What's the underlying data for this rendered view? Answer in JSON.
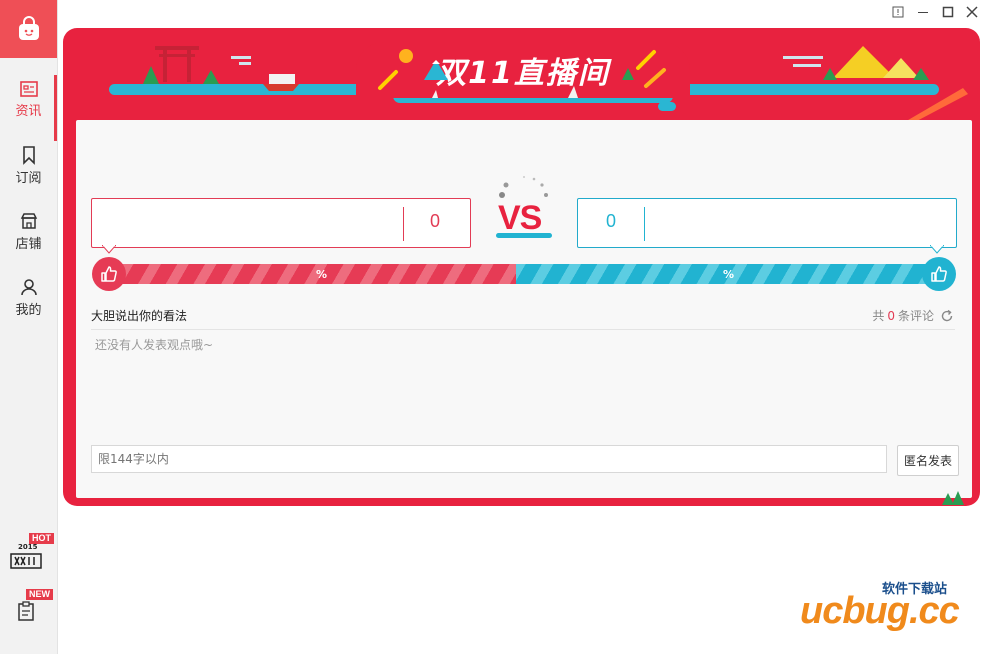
{
  "sidebar": {
    "items": [
      {
        "label": "资讯",
        "icon": "news-icon",
        "active": true
      },
      {
        "label": "订阅",
        "icon": "bookmark-icon",
        "active": false
      },
      {
        "label": "店铺",
        "icon": "shop-icon",
        "active": false
      },
      {
        "label": "我的",
        "icon": "user-icon",
        "active": false
      }
    ],
    "promo": [
      {
        "badge": "HOT",
        "icon": "double11-2015-icon",
        "logo_text": "2015"
      },
      {
        "badge": "NEW",
        "icon": "clipboard-icon"
      }
    ]
  },
  "window": {
    "controls": [
      "warning-icon",
      "minimize-icon",
      "maximize-icon",
      "close-icon"
    ]
  },
  "banner": {
    "title": "双11直播间"
  },
  "versus": {
    "label": "VS",
    "left": {
      "count": "0",
      "percent_label": "%"
    },
    "right": {
      "count": "0",
      "percent_label": "%"
    }
  },
  "comments": {
    "title": "大胆说出你的看法",
    "count_prefix": "共",
    "count": "0",
    "count_suffix": "条评论",
    "empty_message": "还没有人发表观点哦~",
    "input_placeholder": "限144字以内",
    "submit_label": "匿名发表"
  },
  "watermark": {
    "text": "ucbug.cc",
    "subtitle": "软件下载站"
  },
  "colors": {
    "brand_red": "#e8223f",
    "vs_blue": "#21b3d1",
    "sidebar_active": "#e63b4a"
  }
}
